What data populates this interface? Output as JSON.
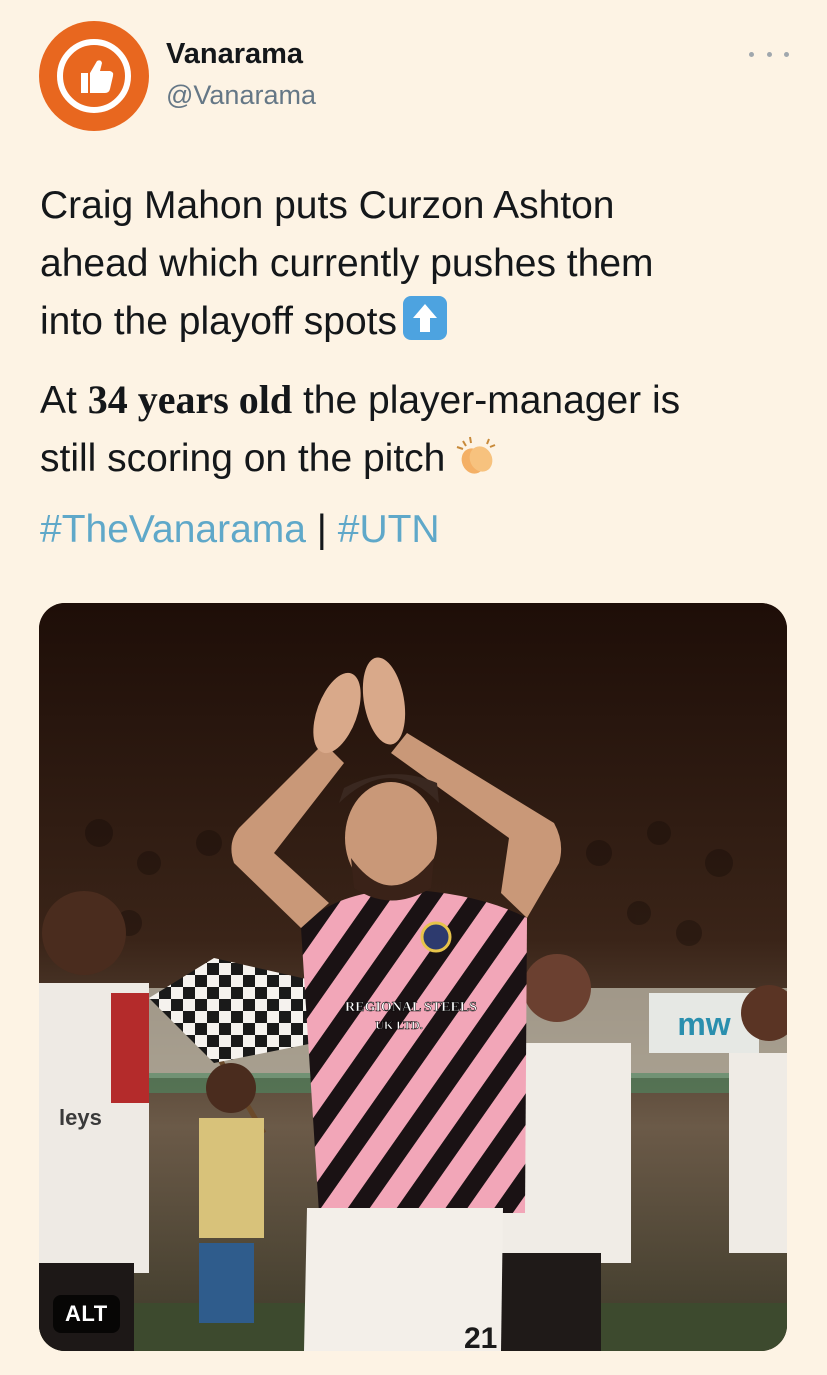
{
  "account": {
    "name": "Vanarama",
    "handle": "@Vanarama",
    "brand_color": "#e8671f",
    "avatar_icon": "thumbs-up-icon"
  },
  "tweet": {
    "line1": "Craig Mahon puts Curzon Ashton",
    "line2": "ahead which currently pushes them",
    "line3": "into the playoff spots",
    "emoji1": "up-arrow-emoji",
    "p2_prefix": "At ",
    "p2_bold": "34 years old",
    "p2_suffix": " the player-manager is",
    "p2_line2": "still scoring on the pitch",
    "emoji2": "clapping-hands-emoji",
    "hashtag1": "#TheVanarama",
    "separator": " | ",
    "hashtag2": "#UTN",
    "hashtag_color": "#5fa8c9"
  },
  "media": {
    "alt_label": "ALT",
    "description_icon": "photo",
    "kit_text_1": "REGIONAL STEELS",
    "kit_text_2": "UK LTD.",
    "shirt_number": "21",
    "board_text": "mw",
    "side_text": "leys"
  }
}
